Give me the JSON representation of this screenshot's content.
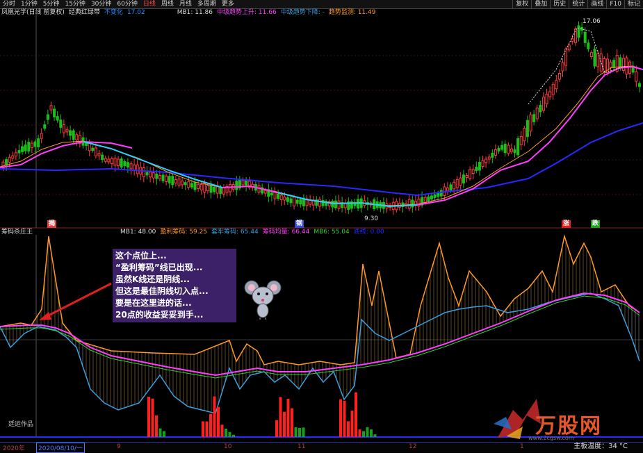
{
  "toolbar": {
    "tabs": [
      "分时",
      "1分钟",
      "5分钟",
      "15分钟",
      "30分钟",
      "60分钟",
      "日线",
      "周线",
      "月线",
      "多周期",
      "更多"
    ],
    "active_tab": "日线",
    "right_buttons": [
      "复权",
      "叠加",
      "历史",
      "统计",
      "画线",
      "F10",
      "标记"
    ]
  },
  "main_pane": {
    "stock_name": "凤凰光学(日线 前复权)",
    "indicator_name": "经典红绿带",
    "indicator_status": "不变化",
    "indicator_value": "17.02",
    "mb1": "MB1: 11.86",
    "line_up": "中级趋势上升: 11.66",
    "line_down": "中级趋势下降: -",
    "support": "趋势监测: 11.49",
    "high_label": "17.06",
    "low_label": "9.30",
    "signals": [
      {
        "text": "揭",
        "color": "#d94040"
      },
      {
        "text": "钢",
        "color": "#d94040"
      },
      {
        "text": "涨",
        "color": "#e02020"
      },
      {
        "text": "跌",
        "color": "#20a020"
      }
    ]
  },
  "sub_pane": {
    "indicator_name": "筹码杀庄王",
    "mb1": "MB1: 48.00",
    "profit": "盈利筹码: 59.25",
    "trapped": "套牢筹码: 65.44",
    "avg": "筹码均量: 66.44",
    "mb6": "MB6: 55.04",
    "other": "底线: 0.00"
  },
  "annotation": {
    "lines": [
      "这个点位上...",
      "“盈利筹码”线已出现...",
      "虽然K线还是阴线...",
      "但这是最佳阴线切入点...",
      "要是在这里进的话...",
      "20点的收益妥妥到手..."
    ]
  },
  "credit": "廷运作品",
  "date_axis": {
    "year_label": "2020年",
    "selected_date": "2020/08/10/一",
    "months": [
      "9",
      "10",
      "11",
      "12",
      "1"
    ]
  },
  "status": {
    "temperature": "主板温度：34 °C"
  },
  "watermark": {
    "brand": "万股网",
    "url": "www.2cgsw.com"
  },
  "colors": {
    "up": "#ff3c3c",
    "down": "#18c018",
    "ma_pink": "#ff3cff",
    "ma_blue": "#2828ff",
    "profit_line": "#ff9a28",
    "trapped_line": "#3aa0e0"
  }
}
